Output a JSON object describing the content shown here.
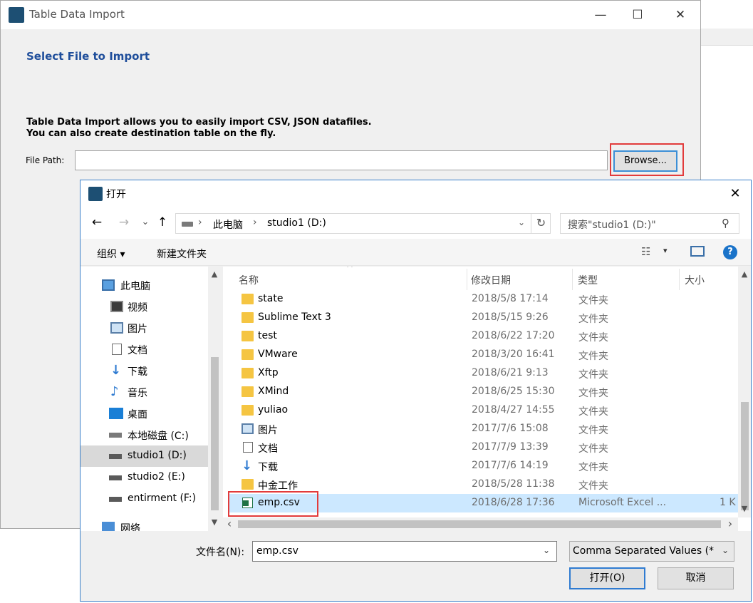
{
  "import_window": {
    "title": "Table Data Import",
    "minimize_glyph": "—",
    "maximize_glyph": "☐",
    "close_glyph": "✕",
    "heading": "Select File to Import",
    "description_line1": "Table Data Import allows you to easily import CSV, JSON datafiles.",
    "description_line2": "You can also create destination table on the fly.",
    "file_path_label": "File Path:",
    "file_path_value": "",
    "browse_label": "Browse..."
  },
  "open_dialog": {
    "title": "打开",
    "close_glyph": "✕",
    "nav": {
      "back_glyph": "←",
      "forward_glyph": "→",
      "recent_glyph": "⌄",
      "up_glyph": "↑",
      "crumb_sep": "›",
      "crumbs": [
        "此电脑",
        "studio1 (D:)"
      ],
      "dropdown_glyph": "⌄",
      "refresh_glyph": "↻",
      "search_placeholder": "搜索\"studio1 (D:)\"",
      "search_glyph": "⚲"
    },
    "toolbar": {
      "organize": "组织 ▾",
      "new_folder": "新建文件夹",
      "view_glyph": "☷",
      "view_dd_glyph": "▾",
      "help_glyph": "?"
    },
    "sidebar": {
      "scroll_up": "▲",
      "scroll_down": "▼",
      "items": [
        {
          "label": "此电脑",
          "icon": "pc-icon"
        },
        {
          "label": "视频",
          "icon": "video-icon"
        },
        {
          "label": "图片",
          "icon": "pictures-icon"
        },
        {
          "label": "文档",
          "icon": "documents-icon"
        },
        {
          "label": "下载",
          "icon": "download-icon"
        },
        {
          "label": "音乐",
          "icon": "music-icon"
        },
        {
          "label": "桌面",
          "icon": "desktop-icon"
        },
        {
          "label": "本地磁盘 (C:)",
          "icon": "drive-icon"
        },
        {
          "label": "studio1 (D:)",
          "icon": "drive-icon"
        },
        {
          "label": "studio2 (E:)",
          "icon": "drive-icon"
        },
        {
          "label": "entirment (F:)",
          "icon": "drive-icon"
        },
        {
          "label": "网络",
          "icon": "network-icon"
        }
      ]
    },
    "file_list": {
      "sort_glyph": "^",
      "columns": {
        "name": "名称",
        "date": "修改日期",
        "type": "类型",
        "size": "大小"
      },
      "scroll_up": "▲",
      "scroll_down": "▼",
      "scroll_left": "‹",
      "scroll_right": "›",
      "rows": [
        {
          "name": "state",
          "date": "2018/5/8 17:14",
          "type": "文件夹",
          "size": "",
          "icon": "folder-icon"
        },
        {
          "name": "Sublime Text 3",
          "date": "2018/5/15 9:26",
          "type": "文件夹",
          "size": "",
          "icon": "folder-icon"
        },
        {
          "name": "test",
          "date": "2018/6/22 17:20",
          "type": "文件夹",
          "size": "",
          "icon": "folder-icon"
        },
        {
          "name": "VMware",
          "date": "2018/3/20 16:41",
          "type": "文件夹",
          "size": "",
          "icon": "folder-icon"
        },
        {
          "name": "Xftp",
          "date": "2018/6/21 9:13",
          "type": "文件夹",
          "size": "",
          "icon": "folder-icon"
        },
        {
          "name": "XMind",
          "date": "2018/6/25 15:30",
          "type": "文件夹",
          "size": "",
          "icon": "folder-icon"
        },
        {
          "name": "yuliao",
          "date": "2018/4/27 14:55",
          "type": "文件夹",
          "size": "",
          "icon": "folder-icon"
        },
        {
          "name": "图片",
          "date": "2017/7/6 15:08",
          "type": "文件夹",
          "size": "",
          "icon": "pictures-icon"
        },
        {
          "name": "文档",
          "date": "2017/7/9 13:39",
          "type": "文件夹",
          "size": "",
          "icon": "documents-icon"
        },
        {
          "name": "下载",
          "date": "2017/7/6 14:19",
          "type": "文件夹",
          "size": "",
          "icon": "download-icon"
        },
        {
          "name": "中金工作",
          "date": "2018/5/28 11:38",
          "type": "文件夹",
          "size": "",
          "icon": "folder-icon"
        },
        {
          "name": "emp.csv",
          "date": "2018/6/28 17:36",
          "type": "Microsoft Excel ...",
          "size": "1 K",
          "icon": "excel-csv-icon"
        }
      ]
    },
    "filename_label": "文件名(N):",
    "filename_value": "emp.csv",
    "filename_dd_glyph": "⌄",
    "filter_value": "Comma Separated Values (*",
    "filter_dd_glyph": "⌄",
    "open_label": "打开(O)",
    "cancel_label": "取消"
  },
  "colors": {
    "accent": "#1f4e9b",
    "selection": "#cce8ff",
    "highlight": "#e23b3b",
    "folder": "#f5c542"
  }
}
